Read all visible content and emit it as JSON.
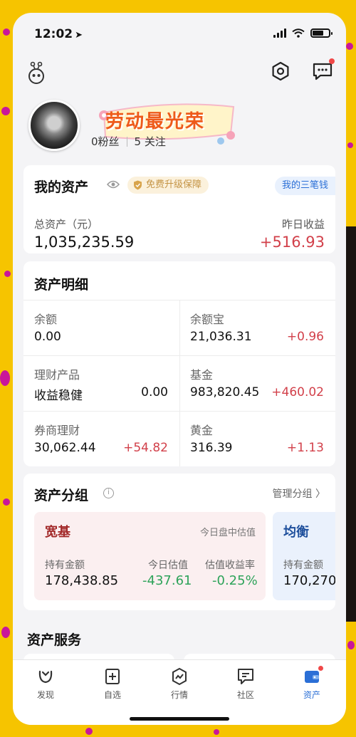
{
  "status_bar": {
    "time": "12:02"
  },
  "profile": {
    "banner_text": "劳动最光荣",
    "fans": "0粉丝",
    "following": "5 关注"
  },
  "assets": {
    "title": "我的资产",
    "badge": "免费升级保障",
    "three_btn": "我的三笔钱",
    "total_label": "总资产（元）",
    "total_value": "1,035,235.59",
    "yesterday_label": "昨日收益",
    "yesterday_value": "+516.93"
  },
  "detail": {
    "title": "资产明细",
    "cells": [
      {
        "label": "余额",
        "value": "0.00",
        "change": ""
      },
      {
        "label": "余额宝",
        "value": "21,036.31",
        "change": "+0.96"
      },
      {
        "label": "理财产品",
        "value": "收益稳健",
        "change": "0.00"
      },
      {
        "label": "基金",
        "value": "983,820.45",
        "change": "+460.02"
      },
      {
        "label": "券商理财",
        "value": "30,062.44",
        "change": "+54.82"
      },
      {
        "label": "黄金",
        "value": "316.39",
        "change": "+1.13"
      }
    ]
  },
  "groups": {
    "title": "资产分组",
    "manage": "管理分组 〉",
    "items": [
      {
        "title": "宽基",
        "estimate": "今日盘中估值",
        "hold_label": "持有金额",
        "hold_value": "178,438.85",
        "today_label": "今日估值",
        "today_value": "-437.61",
        "rate_label": "估值收益率",
        "rate_value": "-0.25%"
      },
      {
        "title": "均衡",
        "hold_label": "持有金额",
        "hold_value": "170,270."
      }
    ]
  },
  "services": {
    "title": "资产服务"
  },
  "tabbar": {
    "items": [
      {
        "label": "发现",
        "icon": "discover-icon"
      },
      {
        "label": "自选",
        "icon": "watchlist-icon"
      },
      {
        "label": "行情",
        "icon": "market-icon"
      },
      {
        "label": "社区",
        "icon": "community-icon"
      },
      {
        "label": "资产",
        "icon": "wallet-icon"
      }
    ],
    "active": "资产"
  },
  "colors": {
    "up": "#d2404a",
    "down": "#2ea35a",
    "accent": "#2b6fd6",
    "background": "#f6c400"
  }
}
